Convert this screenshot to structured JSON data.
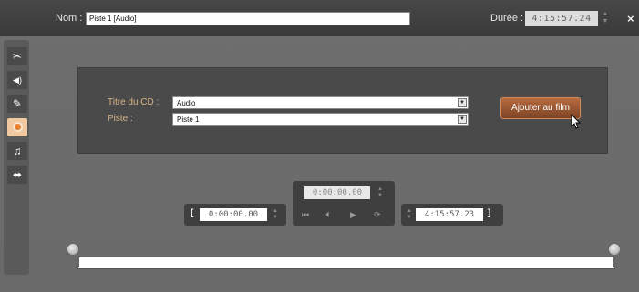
{
  "header": {
    "name_label": "Nom :",
    "name_value": "Piste 1 [Audio]",
    "duration_label": "Durée :",
    "duration_value": "4:15:57.24",
    "close_symbol": "×"
  },
  "toolbar": {
    "tools": [
      {
        "icon": "scissors-icon",
        "glyph": "✂"
      },
      {
        "icon": "speaker-icon",
        "glyph": "◀)"
      },
      {
        "icon": "brush-icon",
        "glyph": "✎"
      },
      {
        "icon": "disc-icon",
        "glyph": "",
        "active": true
      },
      {
        "icon": "music-note-icon",
        "glyph": "♫"
      },
      {
        "icon": "plug-icon",
        "glyph": "⬌"
      }
    ]
  },
  "panel": {
    "cd_title_label": "Titre du CD :",
    "cd_title_value": "Audio",
    "track_label": "Piste :",
    "track_value": "Piste 1",
    "add_button_label": "Ajouter au film"
  },
  "transport": {
    "in_bracket": "[",
    "in_time": "0:00:00.00",
    "current_time": "0:00:00.00",
    "out_time": "4:15:57.23",
    "out_bracket": "]"
  },
  "colors": {
    "accent": "#e87d2c",
    "button": "#9a5630",
    "panel": "#4a4a4a",
    "background": "#6b6b6b"
  }
}
